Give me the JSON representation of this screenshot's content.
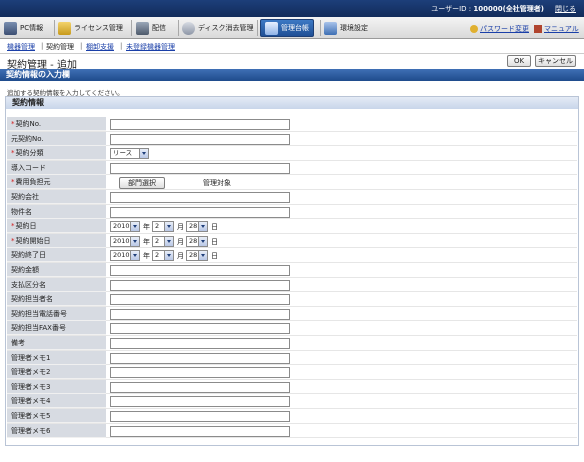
{
  "header": {
    "user_label": "ユーザーID : ",
    "user_value": "100000(全社管理者)",
    "logout": "閉じる"
  },
  "nav": {
    "items": [
      {
        "label": "PC情報",
        "icon": "pc-icon"
      },
      {
        "label": "ライセンス管理",
        "icon": "license-icon"
      },
      {
        "label": "配信",
        "icon": "distribution-icon"
      },
      {
        "label": "ディスク消去管理",
        "icon": "disk-erase-icon"
      },
      {
        "label": "管理台帳",
        "icon": "ledger-icon"
      },
      {
        "label": "環境設定",
        "icon": "settings-icon"
      }
    ],
    "password_change": "パスワード変更",
    "manual": "マニュアル"
  },
  "subnav": {
    "items": [
      "機器管理",
      "契約管理",
      "棚卸支援",
      "未登録機器管理"
    ]
  },
  "page": {
    "title": "契約管理 - 追加",
    "ok": "OK",
    "cancel": "キャンセル",
    "section": "契約情報の入力欄",
    "intro": "追加する契約情報を入力してください。",
    "panel_title": "契約情報"
  },
  "form": {
    "contract_no": "契約No.",
    "orig_contract_no": "元契約No.",
    "contract_type": "契約分類",
    "contract_type_value": "リース",
    "import_code": "導入コード",
    "cost_owner": "費用負担元",
    "dept_select": "部門選択",
    "manage_target": "管理対象",
    "contract_company": "契約会社",
    "property_name": "物件名",
    "contract_date": "契約日",
    "start_date": "契約開始日",
    "end_date": "契約終了日",
    "year": "2010",
    "month": "2",
    "day": "28",
    "year_unit": "年",
    "month_unit": "月",
    "day_unit": "日",
    "amount": "契約金額",
    "payment_type": "支払区分名",
    "person": "契約担当者名",
    "phone": "契約担当電話番号",
    "fax": "契約担当FAX番号",
    "note": "備考",
    "memo1": "管理者メモ1",
    "memo2": "管理者メモ2",
    "memo3": "管理者メモ3",
    "memo4": "管理者メモ4",
    "memo5": "管理者メモ5",
    "memo6": "管理者メモ6",
    "required_mark": "*"
  }
}
